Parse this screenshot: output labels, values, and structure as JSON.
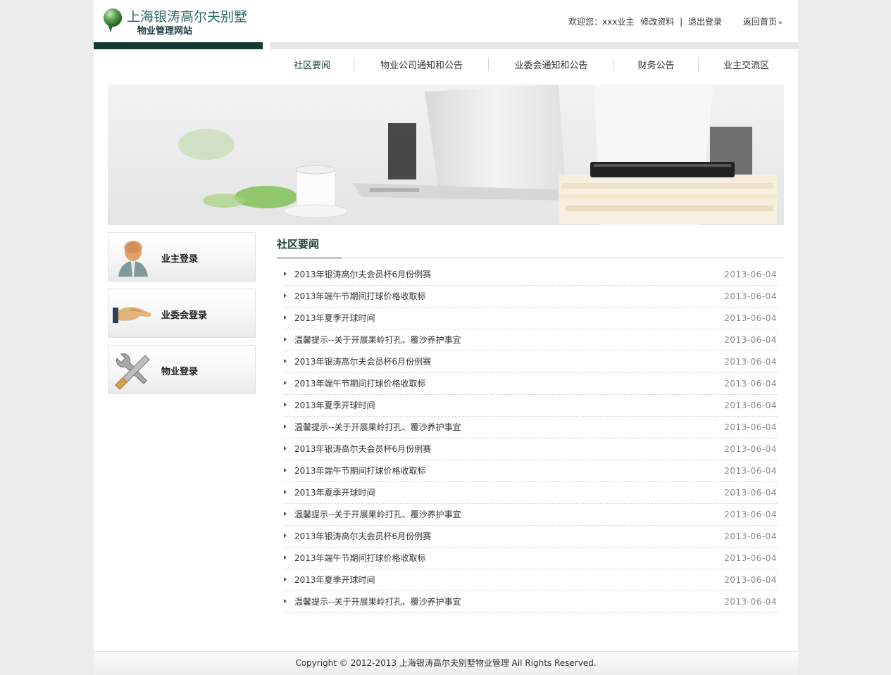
{
  "header": {
    "logo_line1": "上海银涛高尔夫别墅",
    "logo_line2": "物业管理网站",
    "welcome": "欢迎您：xxx业主",
    "edit_profile": "修改资料",
    "separator": "|",
    "logout": "退出登录",
    "home": "返回首页",
    "home_arrow": "»"
  },
  "nav": {
    "items": [
      {
        "label": "社区要闻"
      },
      {
        "label": "物业公司通知和公告"
      },
      {
        "label": "业委会通知和公告"
      },
      {
        "label": "财务公告"
      },
      {
        "label": "业主交流区"
      }
    ]
  },
  "sidebar": {
    "owner_login": "业主登录",
    "committee_login": "业委会登录",
    "property_login": "物业登录"
  },
  "news": {
    "title": "社区要闻",
    "items": [
      {
        "title": "2013年银涛高尔夫会员杯6月份例赛",
        "date": "2013-06-04"
      },
      {
        "title": "2013年端午节期间打球价格收取标",
        "date": "2013-06-04"
      },
      {
        "title": "2013年夏季开球时间",
        "date": "2013-06-04"
      },
      {
        "title": "温馨提示--关于开展果岭打孔、覆沙养护事宜",
        "date": "2013-06-04"
      },
      {
        "title": "2013年银涛高尔夫会员杯6月份例赛",
        "date": "2013-06-04"
      },
      {
        "title": "2013年端午节期间打球价格收取标",
        "date": "2013-06-04"
      },
      {
        "title": "2013年夏季开球时间",
        "date": "2013-06-04"
      },
      {
        "title": "温馨提示--关于开展果岭打孔、覆沙养护事宜",
        "date": "2013-06-04"
      },
      {
        "title": "2013年银涛高尔夫会员杯6月份例赛",
        "date": "2013-06-04"
      },
      {
        "title": "2013年端午节期间打球价格收取标",
        "date": "2013-06-04"
      },
      {
        "title": "2013年夏季开球时间",
        "date": "2013-06-04"
      },
      {
        "title": "温馨提示--关于开展果岭打孔、覆沙养护事宜",
        "date": "2013-06-04"
      },
      {
        "title": "2013年银涛高尔夫会员杯6月份例赛",
        "date": "2013-06-04"
      },
      {
        "title": "2013年端午节期间打球价格收取标",
        "date": "2013-06-04"
      },
      {
        "title": "2013年夏季开球时间",
        "date": "2013-06-04"
      },
      {
        "title": "温馨提示--关于开展果岭打孔、覆沙养护事宜",
        "date": "2013-06-04"
      }
    ]
  },
  "footer": {
    "copyright": "Copyright © 2012-2013 上海银涛高尔夫别墅物业管理 All Rights Reserved."
  },
  "icons": {
    "logo": "golf-ball-icon",
    "owner": "user-icon",
    "committee": "handshake-icon",
    "property": "tools-icon",
    "bullet": "triangle-right-icon"
  },
  "colors": {
    "accent": "#123a32",
    "title": "#1a3d35",
    "date": "#8a8a8a"
  }
}
